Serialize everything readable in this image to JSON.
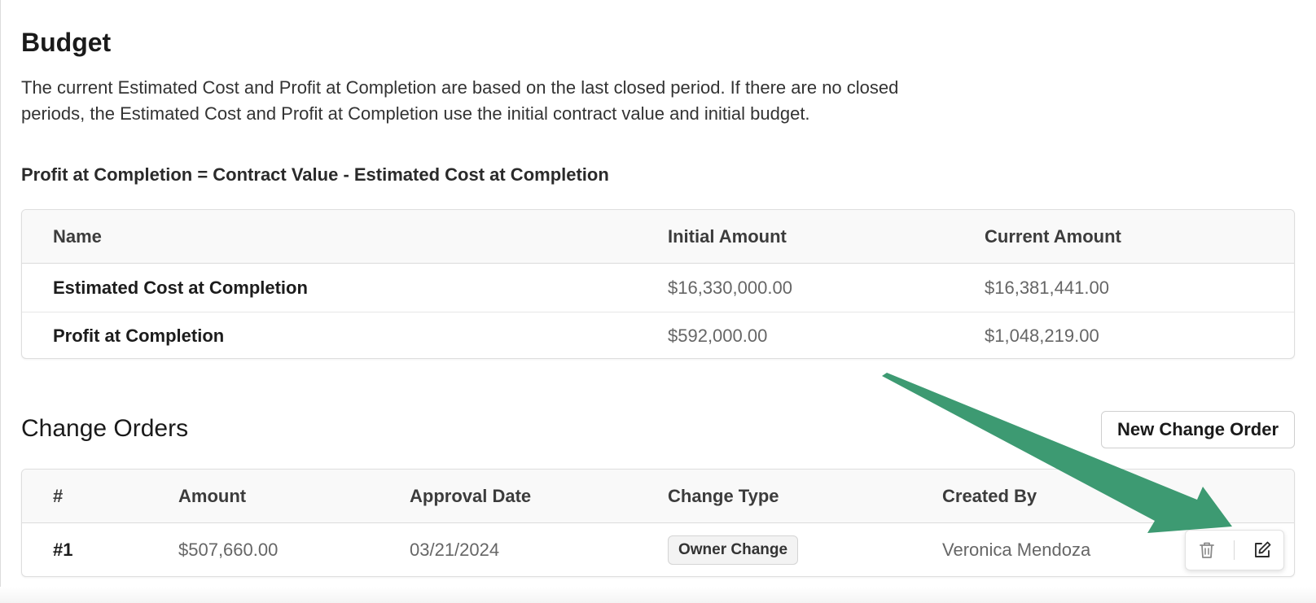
{
  "budget": {
    "title": "Budget",
    "description": "The current Estimated Cost and Profit at Completion are based on the last closed period. If there are no closed periods, the Estimated Cost and Profit at Completion use the initial contract value and initial budget.",
    "formula": "Profit at Completion = Contract Value - Estimated Cost at Completion",
    "table": {
      "headers": {
        "name": "Name",
        "initial": "Initial Amount",
        "current": "Current Amount"
      },
      "rows": [
        {
          "name": "Estimated Cost at Completion",
          "initial": "$16,330,000.00",
          "current": "$16,381,441.00"
        },
        {
          "name": "Profit at Completion",
          "initial": "$592,000.00",
          "current": "$1,048,219.00"
        }
      ]
    }
  },
  "change_orders": {
    "title": "Change Orders",
    "new_button_label": "New Change Order",
    "table": {
      "headers": {
        "num": "#",
        "amount": "Amount",
        "approval_date": "Approval Date",
        "change_type": "Change Type",
        "created_by": "Created By"
      },
      "rows": [
        {
          "num": "#1",
          "amount": "$507,660.00",
          "approval_date": "03/21/2024",
          "change_type": "Owner Change",
          "created_by": "Veronica Mendoza"
        }
      ]
    },
    "row_actions": {
      "delete_icon": "trash-icon",
      "edit_icon": "edit-icon"
    }
  },
  "annotation": {
    "arrow_color": "#3d9a72"
  }
}
